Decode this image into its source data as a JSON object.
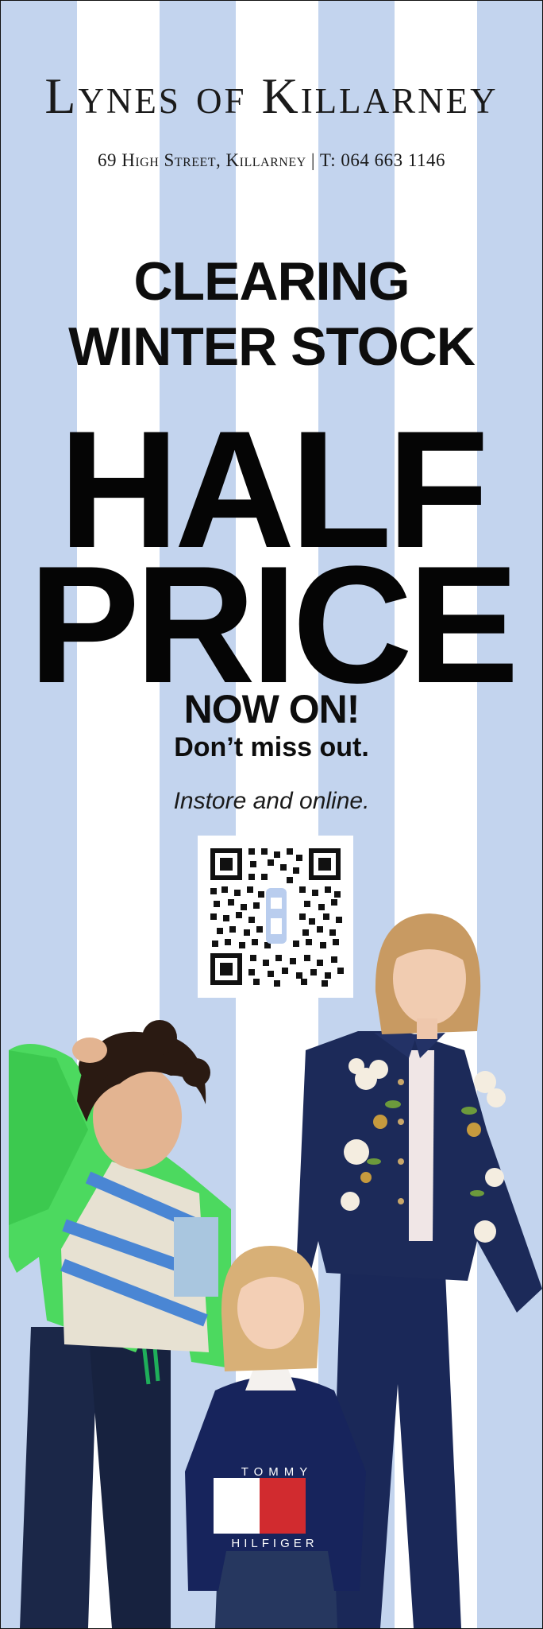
{
  "store": {
    "name": "Lynes of Killarney",
    "address_line": "69 High Street, Killarney  |  T: 064 663 1146"
  },
  "promo": {
    "headline_line1": "CLEARING",
    "headline_line2": "WINTER STOCK",
    "half": "HALF",
    "price": "PRICE",
    "now_on": "NOW ON!",
    "dont_miss": "Don’t miss out.",
    "instore": "Instore and online."
  },
  "apparel": {
    "sweater_brand_top": "TOMMY",
    "sweater_brand_bottom": "HILFIGER"
  },
  "icons": {
    "qr": "qr-code-icon"
  },
  "colors": {
    "stripe_blue": "#c3d4ee",
    "stripe_white": "#ffffff",
    "text": "#0d0d0d",
    "navy": "#15234a",
    "tommy_red": "#d12b2f"
  }
}
